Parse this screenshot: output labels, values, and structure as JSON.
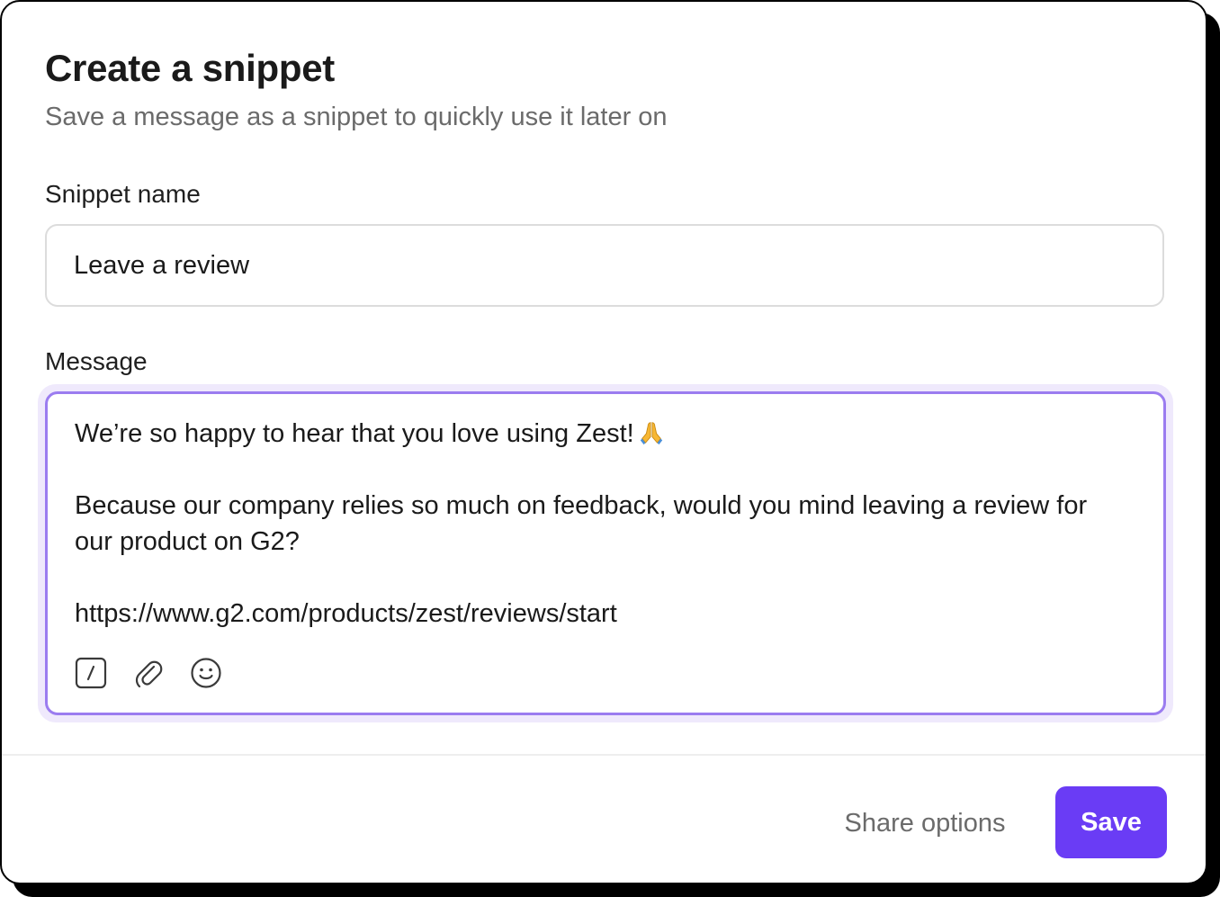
{
  "dialog": {
    "title": "Create a snippet",
    "subtitle": "Save a message as a snippet to quickly use it later on"
  },
  "snippet_name": {
    "label": "Snippet name",
    "value": "Leave a review"
  },
  "message": {
    "label": "Message",
    "paragraphs": [
      "We’re so happy to hear that you love using Zest!",
      "Because our company relies so much on feedback, would you mind leaving a review for our product on G2?",
      "https://www.g2.com/products/zest/reviews/start"
    ],
    "trailing_emoji": "folded-hands-emoji",
    "toolbar": [
      "slash-command-icon",
      "paperclip-icon",
      "smiley-icon"
    ]
  },
  "footer": {
    "share_label": "Share options",
    "save_label": "Save"
  },
  "colors": {
    "accent": "#6a3cf5",
    "focus_border": "#9b7cf0",
    "focus_ring": "#efe9fc",
    "muted_text": "#6b6b6b"
  }
}
